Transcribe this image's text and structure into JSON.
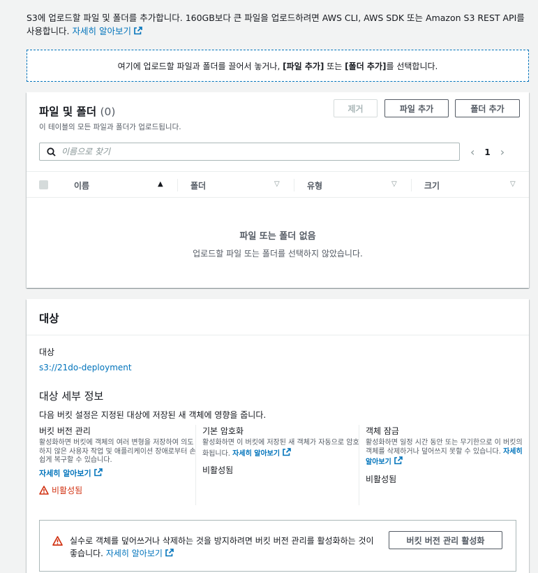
{
  "intro": {
    "text": "S3에 업로드할 파일 및 폴더를 추가합니다. 160GB보다 큰 파일을 업로드하려면 AWS CLI, AWS SDK 또는 Amazon S3 REST API를 사용합니다.",
    "link": "자세히 알아보기"
  },
  "dropzone": {
    "prefix": "여기에 업로드할 파일과 폴더를 끌어서 놓거나,",
    "add_files": "[파일 추가]",
    "middle": "또는",
    "add_folder": "[폴더 추가]",
    "suffix": "를 선택합니다."
  },
  "files": {
    "title": "파일 및 폴더",
    "count": "(0)",
    "subtitle": "이 테이블의 모든 파일과 폴더가 업로드됩니다.",
    "remove_label": "제거",
    "add_file_label": "파일 추가",
    "add_folder_label": "폴더 추가",
    "search_placeholder": "이름으로 찾기",
    "page": "1",
    "columns": [
      "이름",
      "폴더",
      "유형",
      "크기"
    ],
    "empty_title": "파일 또는 폴더 없음",
    "empty_sub": "업로드할 파일 또는 폴더를 선택하지 않았습니다."
  },
  "target": {
    "title": "대상",
    "dest_label": "대상",
    "dest_value": "s3://21do-deployment",
    "details_title": "대상 세부 정보",
    "details_desc": "다음 버킷 설정은 지정된 대상에 저장된 새 객체에 영향을 줍니다.",
    "versioning": {
      "title": "버킷 버전 관리",
      "desc": "활성화하면 버킷에 객체의 여러 변형을 저장하여 의도하지 않은 사용자 작업 및 애플리케이션 장애로부터 손쉽게 복구할 수 있습니다.",
      "link": "자세히 알아보기",
      "status": "비활성됨"
    },
    "encryption": {
      "title": "기본 암호화",
      "desc": "활성화하면 이 버킷에 저장된 새 객체가 자동으로 암호화됩니다.",
      "link": "자세히 알아보기",
      "status": "비활성됨"
    },
    "lock": {
      "title": "객체 잠금",
      "desc": "활성화하면 일정 시간 동안 또는 무기한으로 이 버킷의 객체를 삭제하거나 덮어쓰지 못할 수 있습니다.",
      "link": "자세히 알아보기",
      "status": "비활성됨"
    },
    "alert": {
      "message": "실수로 객체를 덮어쓰거나 삭제하는 것을 방지하려면 버킷 버전 관리를 활성화하는 것이 좋습니다.",
      "link": "자세히 알아보기",
      "button": "버킷 버전 관리 활성화"
    }
  },
  "colors": {
    "link": "#0073bb",
    "warning": "#d13212",
    "text": "#16191f",
    "muted": "#545b64"
  }
}
